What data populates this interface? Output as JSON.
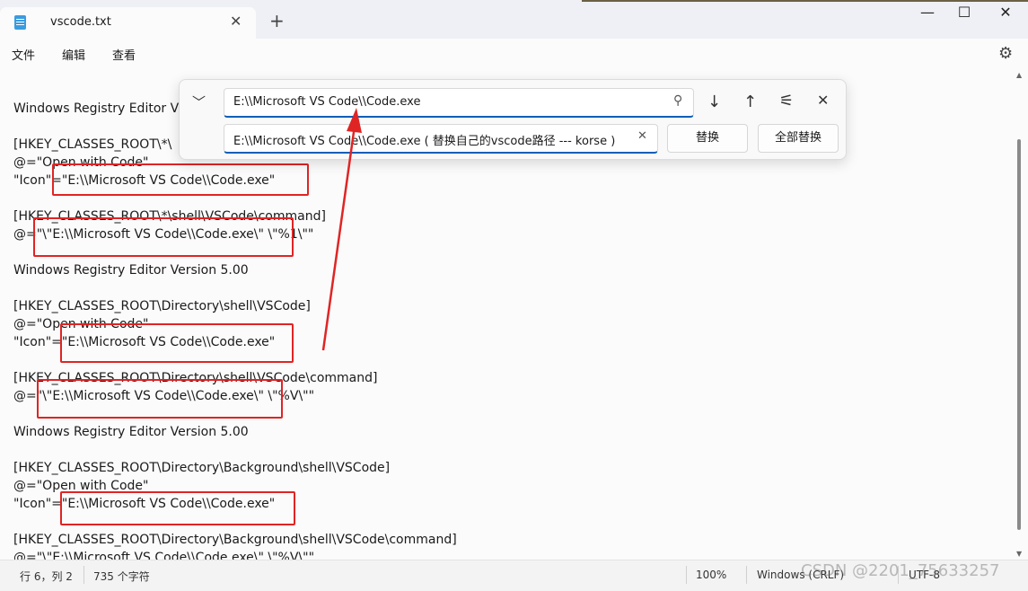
{
  "window": {
    "tab_title": "vscode.txt",
    "tab_close": "✕",
    "new_tab": "+",
    "minimize": "—",
    "maximize": "☐",
    "close": "✕"
  },
  "menu": {
    "items": [
      "文件",
      "编辑",
      "查看"
    ]
  },
  "editor": {
    "lines": [
      "Windows Registry Editor V",
      "",
      "[HKEY_CLASSES_ROOT\\*\\",
      "@=\"Open with Code\"",
      "\"Icon\"=\"E:\\\\Microsoft VS Code\\\\Code.exe\"",
      "",
      "[HKEY_CLASSES_ROOT\\*\\shell\\VSCode\\command]",
      "@=\"\\\"E:\\\\Microsoft VS Code\\\\Code.exe\\\" \\\"%1\\\"\"",
      "",
      "Windows Registry Editor Version 5.00",
      "",
      "[HKEY_CLASSES_ROOT\\Directory\\shell\\VSCode]",
      "@=\"Open with Code\"",
      "\"Icon\"=\"E:\\\\Microsoft VS Code\\\\Code.exe\"",
      "",
      "[HKEY_CLASSES_ROOT\\Directory\\shell\\VSCode\\command]",
      "@=\"\\\"E:\\\\Microsoft VS Code\\\\Code.exe\\\" \\\"%V\\\"\"",
      "",
      "Windows Registry Editor Version 5.00",
      "",
      "[HKEY_CLASSES_ROOT\\Directory\\Background\\shell\\VSCode]",
      "@=\"Open with Code\"",
      "\"Icon\"=\"E:\\\\Microsoft VS Code\\\\Code.exe\"",
      "",
      "[HKEY_CLASSES_ROOT\\Directory\\Background\\shell\\VSCode\\command]",
      "@=\"\\\"E:\\\\Microsoft VS Code\\\\Code.exe\\\" \\\"%V\\\"\""
    ]
  },
  "find_replace": {
    "find_value": "E:\\\\Microsoft VS Code\\\\Code.exe",
    "replace_value": "E:\\\\Microsoft VS Code\\\\Code.exe ( 替换自己的vscode路径 --- korse )",
    "replace_button": "替换",
    "replace_all_button": "全部替换"
  },
  "status": {
    "position": "行 6，列 2",
    "char_count": "735 个字符",
    "zoom": "100%",
    "line_ending": "Windows (CRLF)",
    "encoding": "UTF-8"
  },
  "watermark": "CSDN @2201_75633257",
  "colors": {
    "annotation": "#e02424",
    "accent": "#005fb8"
  }
}
